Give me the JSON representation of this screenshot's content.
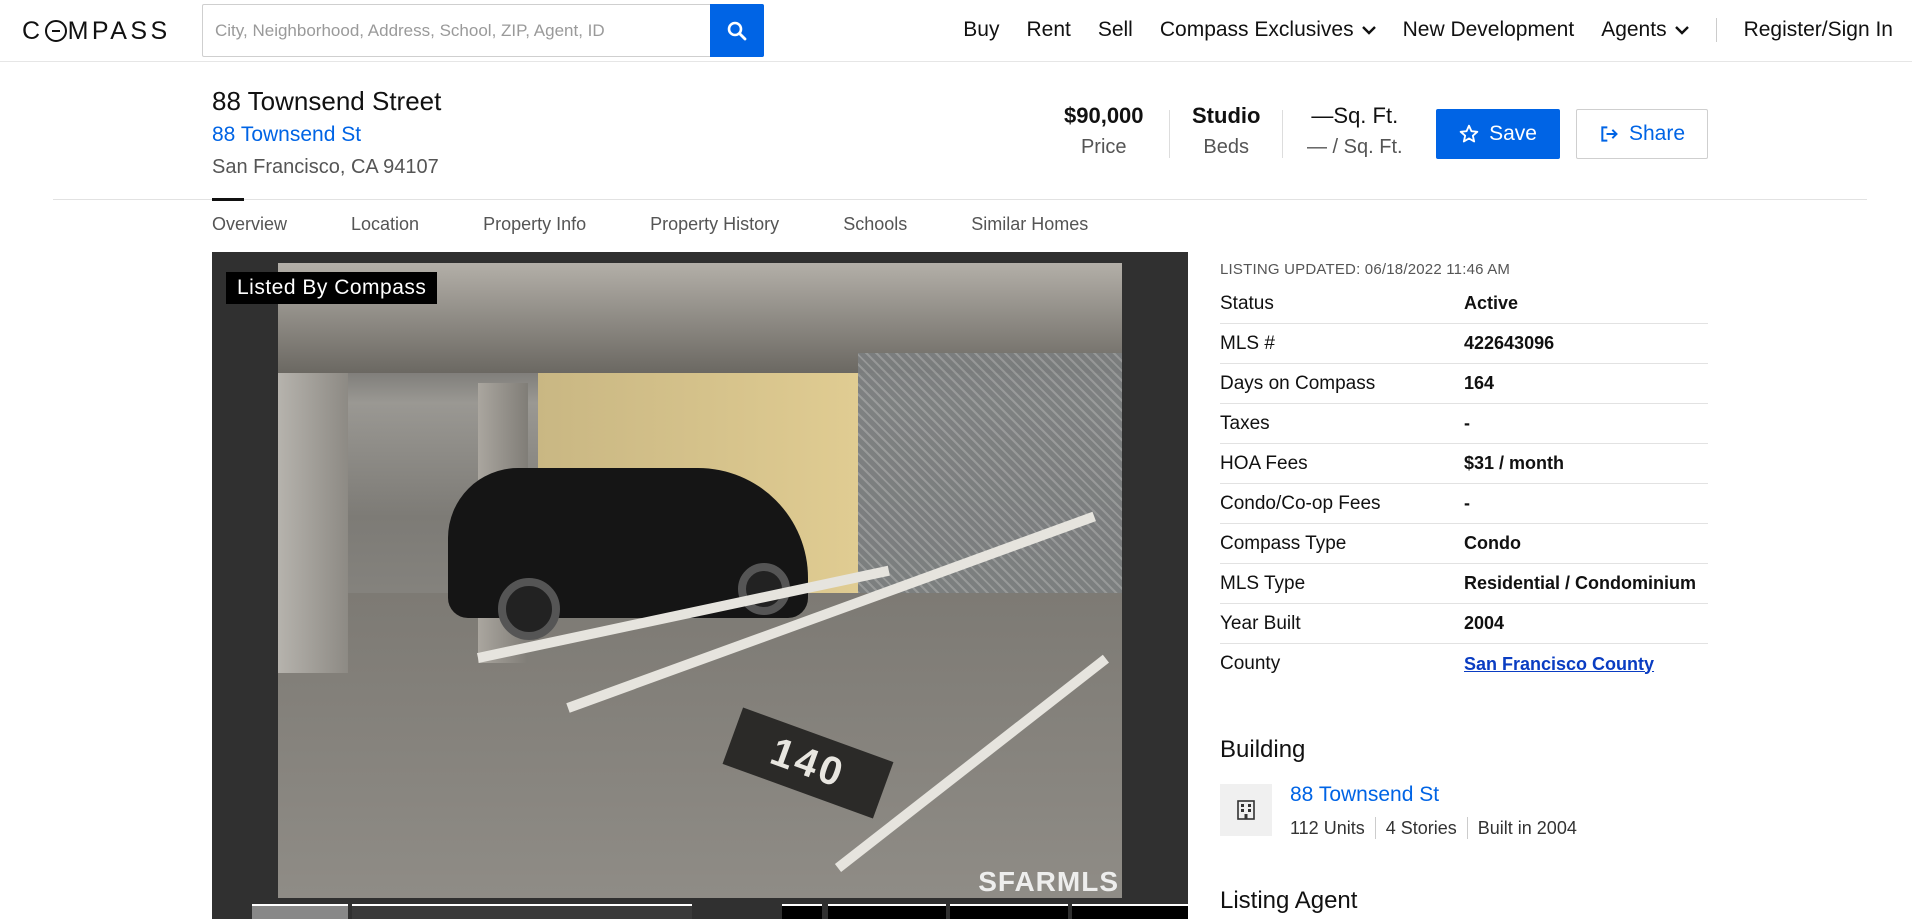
{
  "nav": {
    "logo": "COMPASS",
    "search_placeholder": "City, Neighborhood, Address, School, ZIP, Agent, ID",
    "links": {
      "buy": "Buy",
      "rent": "Rent",
      "sell": "Sell",
      "exclusives": "Compass Exclusives",
      "new_dev": "New Development",
      "agents": "Agents",
      "register": "Register/Sign In"
    }
  },
  "header": {
    "title": "88 Townsend Street",
    "address_link": "88 Townsend St",
    "city": "San Francisco, CA 94107",
    "price_value": "$90,000",
    "price_label": "Price",
    "beds_value": "Studio",
    "beds_label": "Beds",
    "sqft_value": "—Sq. Ft.",
    "sqft_label": "— / Sq. Ft.",
    "save_label": "Save",
    "share_label": "Share"
  },
  "tabs": [
    "Overview",
    "Location",
    "Property Info",
    "Property History",
    "Schools",
    "Similar Homes"
  ],
  "photo": {
    "badge": "Listed By Compass",
    "watermark": "SFARMLS",
    "spot_number": "140"
  },
  "listing": {
    "updated": "LISTING UPDATED: 06/18/2022 11:46 AM",
    "rows": [
      {
        "label": "Status",
        "value": "Active"
      },
      {
        "label": "MLS #",
        "value": "422643096"
      },
      {
        "label": "Days on Compass",
        "value": "164"
      },
      {
        "label": "Taxes",
        "value": "-"
      },
      {
        "label": "HOA Fees",
        "value": "$31 / month"
      },
      {
        "label": "Condo/Co-op Fees",
        "value": "-"
      },
      {
        "label": "Compass Type",
        "value": "Condo"
      },
      {
        "label": "MLS Type",
        "value": "Residential / Condominium"
      },
      {
        "label": "Year Built",
        "value": "2004"
      },
      {
        "label": "County",
        "value": "San Francisco County"
      }
    ]
  },
  "building": {
    "heading": "Building",
    "name": "88 Townsend St",
    "units": "112 Units",
    "stories": "4 Stories",
    "built": "Built in 2004"
  },
  "agent": {
    "heading": "Listing Agent"
  },
  "colors": {
    "accent": "#0064e5",
    "text": "#111111",
    "muted": "#555555"
  }
}
